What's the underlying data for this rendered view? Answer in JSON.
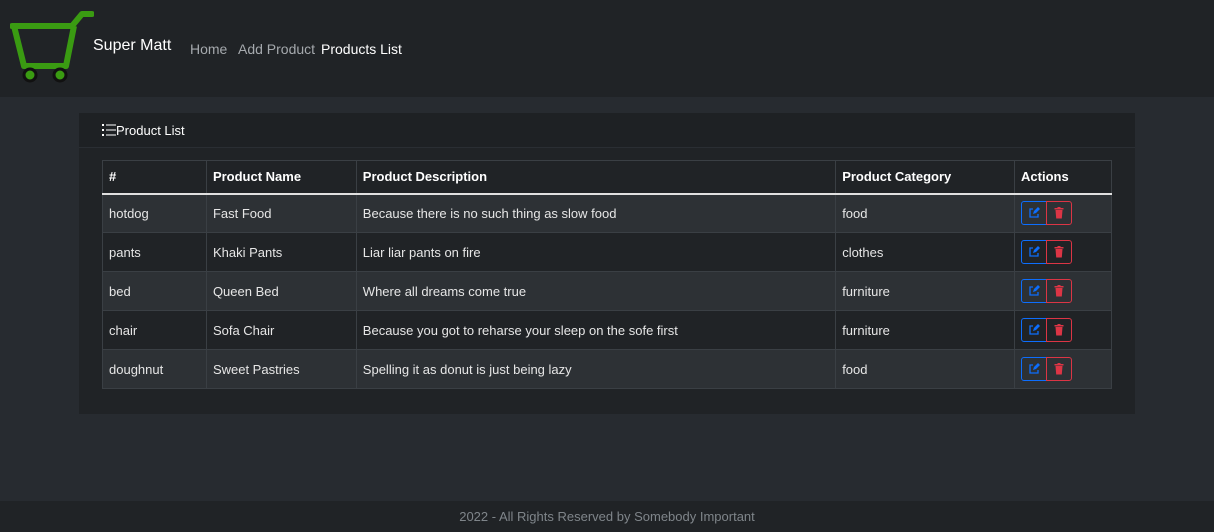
{
  "brand": {
    "name": "Super Matt",
    "logo_icon": "shopping-cart-icon",
    "logo_color": "#3a9b12"
  },
  "nav": {
    "items": [
      {
        "label": "Home"
      },
      {
        "label": "Add Product"
      },
      {
        "label": "Products List"
      }
    ]
  },
  "card": {
    "title": "Product List",
    "icon": "list-icon"
  },
  "table": {
    "headers": [
      "#",
      "Product Name",
      "Product Description",
      "Product Category",
      "Actions"
    ],
    "rows": [
      {
        "id": "hotdog",
        "name": "Fast Food",
        "description": "Because there is no such thing as slow food",
        "category": "food"
      },
      {
        "id": "pants",
        "name": "Khaki Pants",
        "description": "Liar liar pants on fire",
        "category": "clothes"
      },
      {
        "id": "bed",
        "name": "Queen Bed",
        "description": "Where all dreams come true",
        "category": "furniture"
      },
      {
        "id": "chair",
        "name": "Sofa Chair",
        "description": "Because you got to reharse your sleep on the sofe first",
        "category": "furniture"
      },
      {
        "id": "doughnut",
        "name": "Sweet Pastries",
        "description": "Spelling it as donut is just being lazy",
        "category": "food"
      }
    ],
    "action_icons": {
      "edit": "edit-icon",
      "delete": "trash-icon"
    },
    "colors": {
      "edit": "#0d6efd",
      "delete": "#dc3545"
    }
  },
  "footer": {
    "text": "2022 - All Rights Reserved by Somebody Important"
  }
}
